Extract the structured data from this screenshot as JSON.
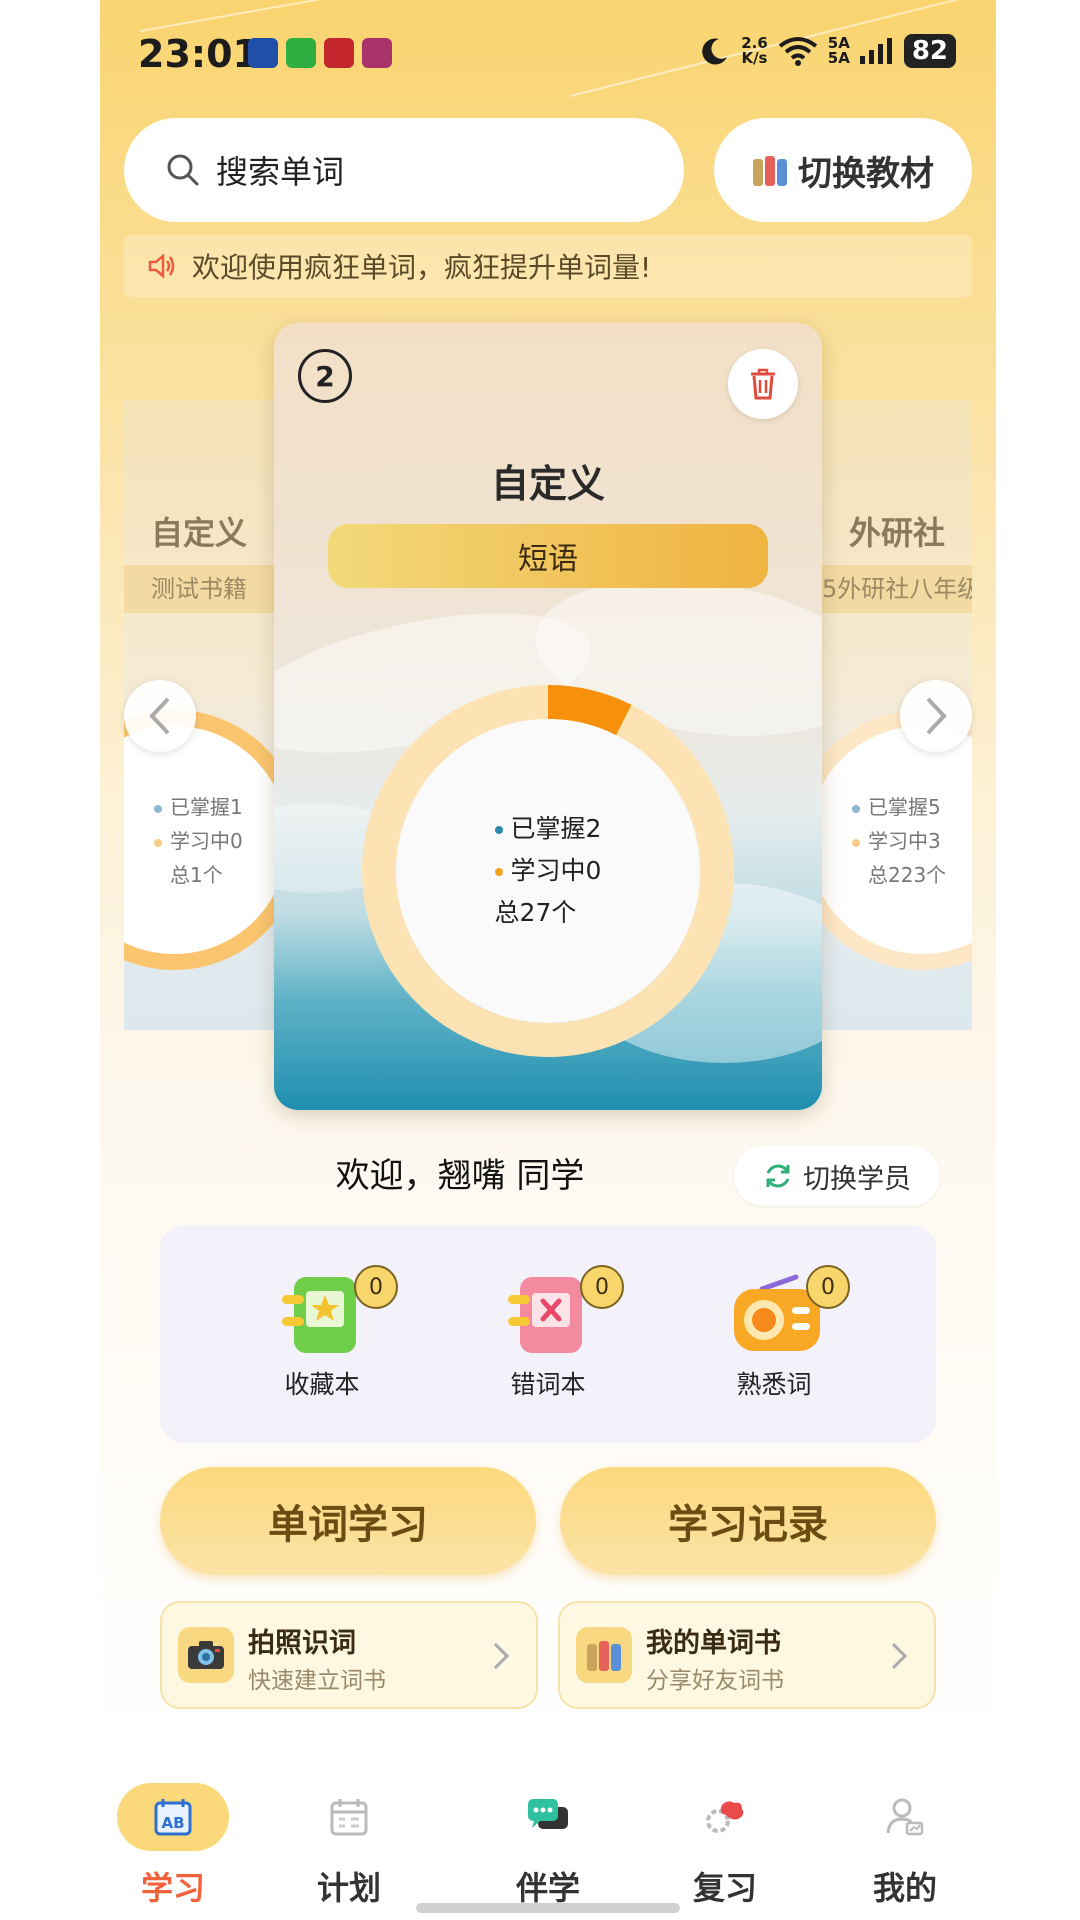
{
  "status_bar": {
    "time": "23:01",
    "net_speed_top": "2.6",
    "net_speed_bottom": "K/s",
    "signal_top": "5A",
    "signal_bottom": "5A",
    "battery": "82",
    "wifi_label": "7"
  },
  "search": {
    "placeholder": "搜索单词"
  },
  "switch_book": {
    "label": "切换教材"
  },
  "notice": {
    "text": "欢迎使用疯狂单词，疯狂提升单词量!"
  },
  "carousel": {
    "left_card": {
      "title": "自定义",
      "subtitle": "测试书籍",
      "mastered": "已掌握1",
      "learning": "学习中0",
      "total": "总1个"
    },
    "center_card": {
      "index": "2",
      "title": "自定义",
      "tag": "短语",
      "mastered": "已掌握2",
      "learning": "学习中0",
      "total": "总27个",
      "progress_fraction": 0.074
    },
    "right_card": {
      "title": "外研社",
      "subtitle": "5外研社八年级",
      "mastered": "已掌握5",
      "learning": "学习中3",
      "total": "总223个"
    }
  },
  "welcome": {
    "text": "欢迎，翘嘴 同学",
    "switch_student": "切换学员"
  },
  "quick_panel": [
    {
      "label": "收藏本",
      "count": "0",
      "icon": "favorites-icon"
    },
    {
      "label": "错词本",
      "count": "0",
      "icon": "wrong-words-icon"
    },
    {
      "label": "熟悉词",
      "count": "0",
      "icon": "radio-icon"
    }
  ],
  "big_buttons": {
    "word_study": "单词学习",
    "study_record": "学习记录"
  },
  "features": [
    {
      "title": "拍照识词",
      "subtitle": "快速建立词书",
      "icon": "camera-icon"
    },
    {
      "title": "我的单词书",
      "subtitle": "分享好友词书",
      "icon": "books-icon"
    }
  ],
  "tabs": [
    {
      "label": "学习",
      "icon": "ab-book-icon",
      "active": true
    },
    {
      "label": "计划",
      "icon": "calendar-icon",
      "active": false
    },
    {
      "label": "伴学",
      "icon": "chat-icon",
      "active": false
    },
    {
      "label": "复习",
      "icon": "brain-icon",
      "active": false
    },
    {
      "label": "我的",
      "icon": "profile-icon",
      "active": false
    }
  ],
  "colors": {
    "accent": "#f2623d",
    "yellow": "#fbd97a",
    "ring_progress": "#f7900a",
    "ring_track": "#fde3b4"
  }
}
